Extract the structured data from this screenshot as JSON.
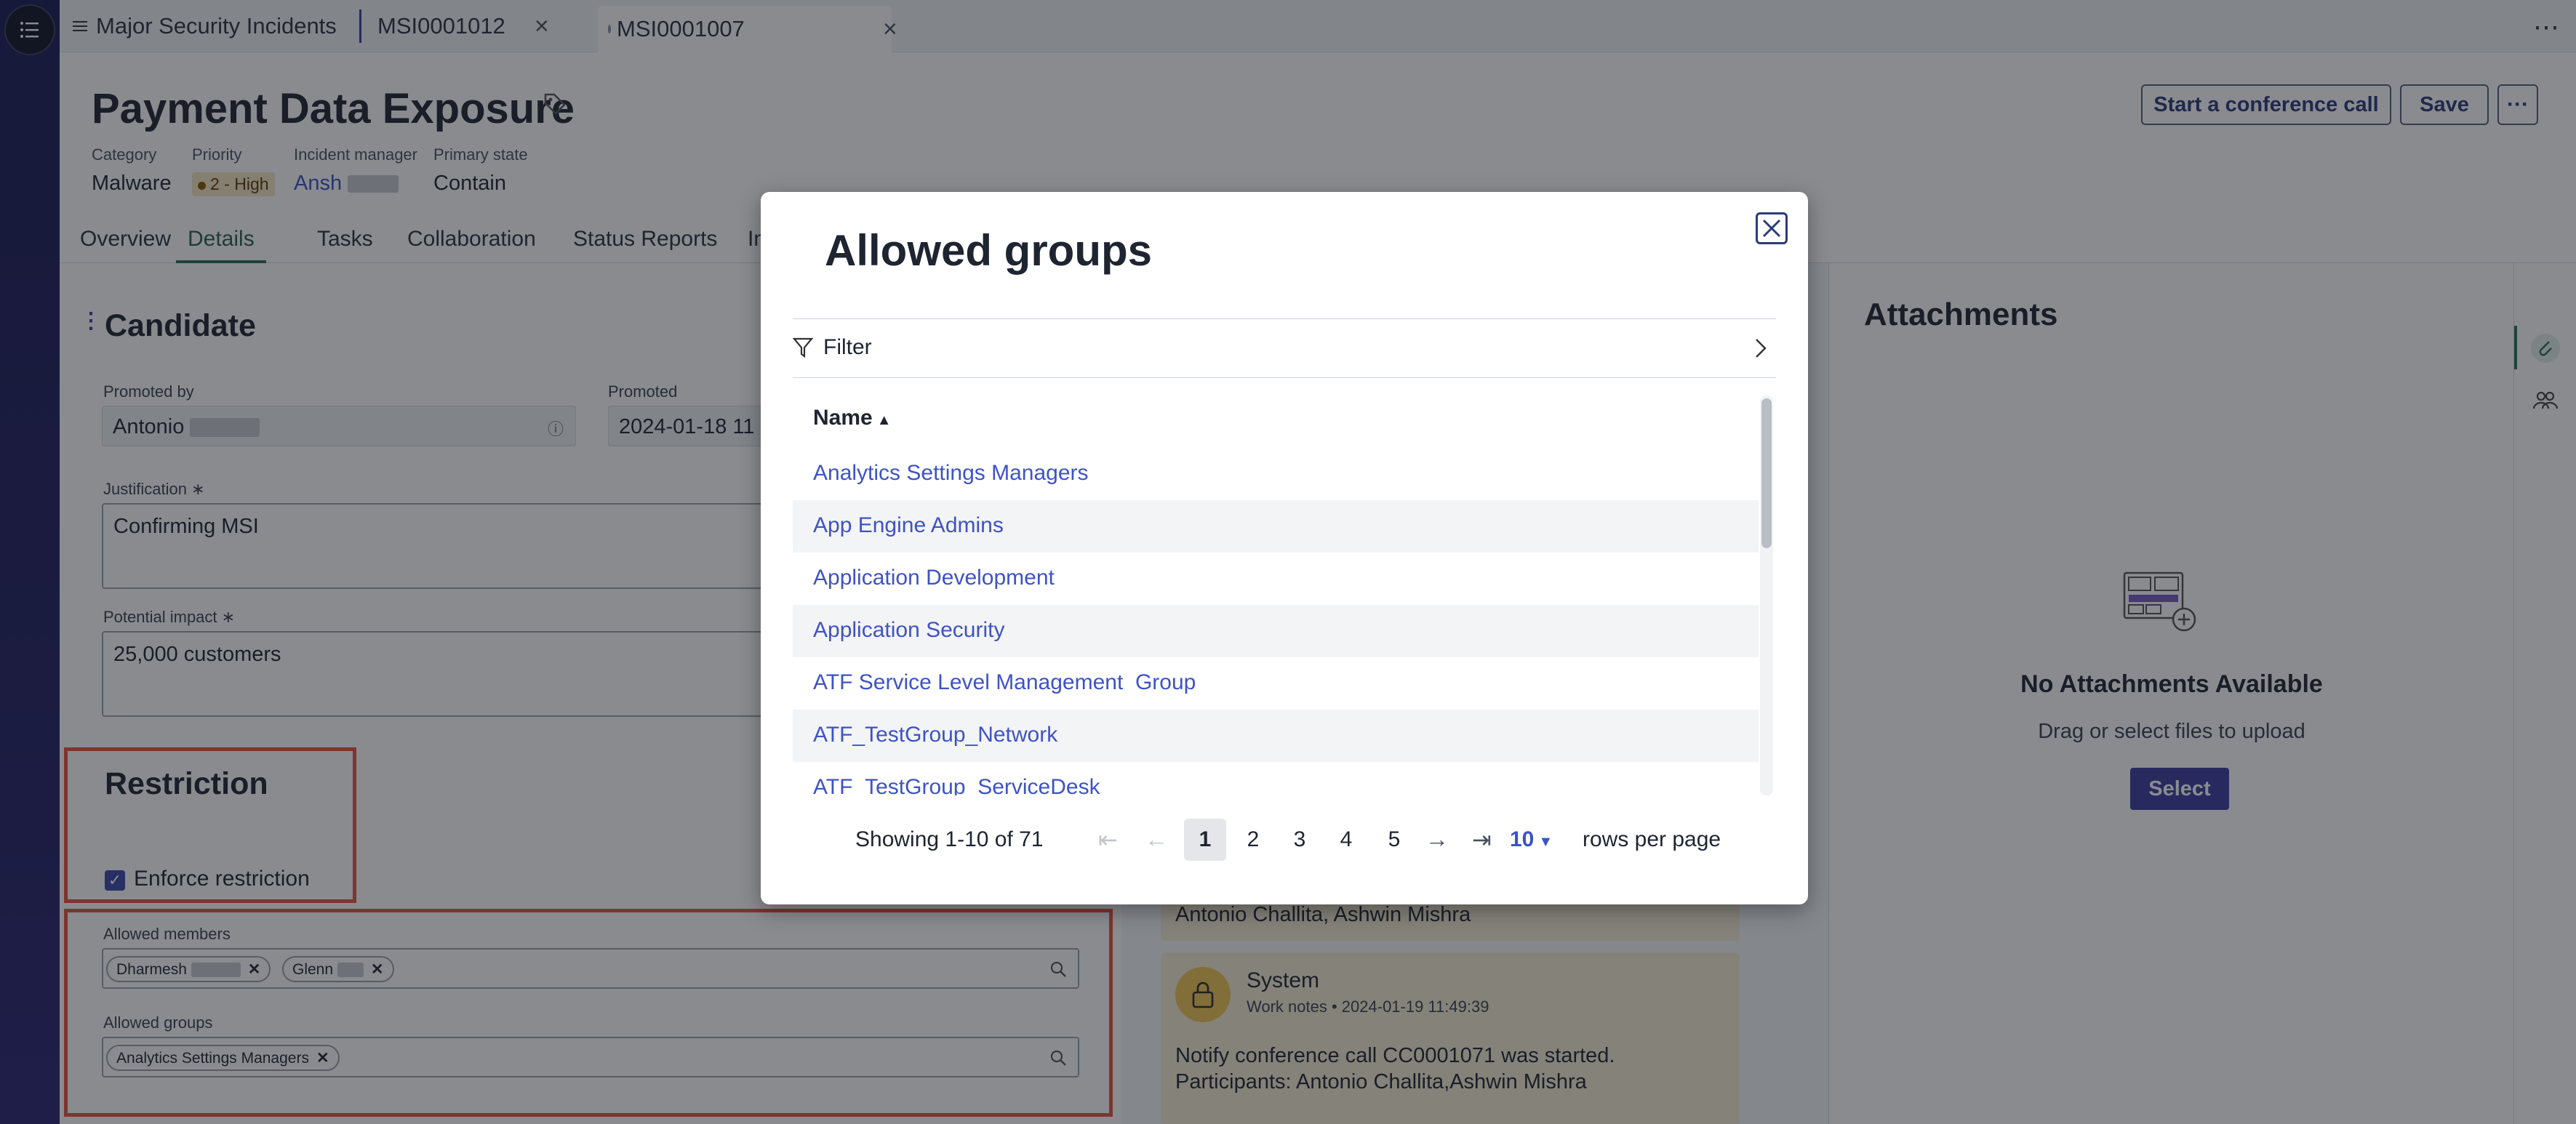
{
  "tabs": [
    {
      "label": "Major Security Incidents"
    },
    {
      "label": "MSI0001012"
    },
    {
      "label": "MSI0001007"
    }
  ],
  "record": {
    "title": "Payment Data Exposure",
    "category_label": "Category",
    "category": "Malware",
    "priority_label": "Priority",
    "priority": "2 - High",
    "manager_label": "Incident manager",
    "manager": "Ansh",
    "state_label": "Primary state",
    "state": "Contain"
  },
  "header_buttons": {
    "conference": "Start a conference call",
    "save": "Save",
    "more": "···"
  },
  "subtabs": [
    "Overview",
    "Details",
    "Tasks",
    "Collaboration",
    "Status Reports",
    "In"
  ],
  "active_subtab": "Details",
  "candidate": {
    "title": "Candidate",
    "promoted_by_label": "Promoted by",
    "promoted_by": "Antonio",
    "promoted_label": "Promoted",
    "promoted": "2024-01-18 11",
    "justification_label": "Justification",
    "justification": "Confirming MSI",
    "impact_label": "Potential impact",
    "impact": "25,000 customers",
    "required_mark": "∗"
  },
  "restriction": {
    "title": "Restriction",
    "enforce_label": "Enforce restriction",
    "enforce_checked": true,
    "allowed_members_label": "Allowed members",
    "allowed_members": [
      "Dharmesh",
      "Glenn"
    ],
    "allowed_groups_label": "Allowed groups",
    "allowed_groups": [
      "Analytics Settings Managers"
    ]
  },
  "activity": {
    "top_card_text": "Antonio Challita, Ashwin Mishra",
    "entry": {
      "author": "System",
      "type": "Work notes",
      "timestamp": "2024-01-19 11:49:39",
      "line1": "Notify conference call CC0001071 was started.",
      "line2": "Participants: Antonio Challita,Ashwin Mishra"
    }
  },
  "attachments": {
    "title": "Attachments",
    "empty_title": "No Attachments Available",
    "empty_hint": "Drag or select files to upload",
    "select_label": "Select"
  },
  "modal": {
    "title": "Allowed groups",
    "filter_label": "Filter",
    "column_name": "Name",
    "rows": [
      "Analytics Settings Managers",
      "App Engine Admins",
      "Application Development",
      "Application Security",
      "ATF Service Level Management  Group",
      "ATF_TestGroup_Network",
      "ATF_TestGroup_ServiceDesk"
    ],
    "showing": "Showing 1-10 of 71",
    "pages": [
      "1",
      "2",
      "3",
      "4",
      "5"
    ],
    "current_page": "1",
    "rows_per_page": "10",
    "rows_per_page_label": "rows per page"
  },
  "colors": {
    "brand": "#3c3d9e",
    "link": "#3d53c6",
    "highlight": "#e8503f",
    "active_tab": "#2d6c52"
  }
}
